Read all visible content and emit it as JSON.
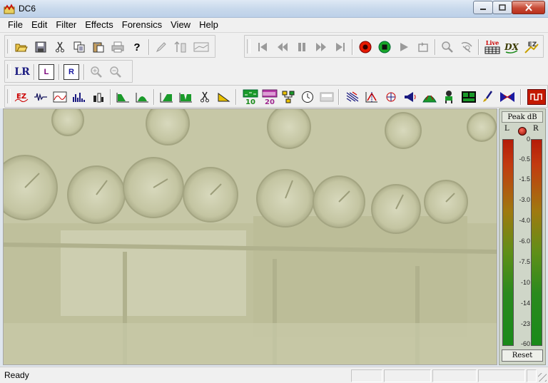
{
  "window": {
    "title": "DC6",
    "status": "Ready"
  },
  "menu": [
    "File",
    "Edit",
    "Filter",
    "Effects",
    "Forensics",
    "View",
    "Help"
  ],
  "icons": {
    "toolbar1_file": [
      "open-folder-icon",
      "save-icon",
      "cut-icon",
      "copy-icon",
      "paste-icon",
      "print-icon",
      "help-icon",
      "pencil-icon",
      "level-icon",
      "waveform-icon"
    ],
    "toolbar1_transport": [
      "skip-start-icon",
      "rewind-icon",
      "pause-icon",
      "fast-forward-icon",
      "skip-end-icon",
      "record-icon",
      "stop-icon",
      "play-icon",
      "loop-icon",
      "zoom-icon",
      "probe-icon",
      "live-icon",
      "dx-icon",
      "ez-icon"
    ],
    "toolbar2": [
      "lr-icon",
      "l-channel-icon",
      "r-channel-icon",
      "zoom-in-icon",
      "zoom-out-icon"
    ],
    "toolbar3": [
      "ez-filter-icon",
      "noise-icon",
      "spectrum-icon",
      "histogram-icon",
      "bars-icon",
      "lowpass-icon",
      "bandpass-icon",
      "highpass-icon",
      "notch-icon",
      "scissors-icon",
      "ramp-icon",
      "eq10-icon",
      "eq20-icon",
      "tree-icon",
      "clock-icon",
      "blank-icon",
      "wavelet-icon",
      "filter-icon",
      "decrackle-icon",
      "speaker-icon",
      "mountain-icon",
      "figure-icon",
      "graph-icon",
      "brush-icon",
      "bowtie-icon",
      "square-wave-icon"
    ]
  },
  "labels": {
    "lr": "LR",
    "l": "L",
    "r": "R",
    "eq10": "10",
    "eq20": "20",
    "live": "Live",
    "dx": "DX",
    "ez": "EZ"
  },
  "meter": {
    "header": "Peak dB",
    "left_label": "L",
    "right_label": "R",
    "scale": [
      "0",
      "-0.5",
      "-1.5",
      "-3.0",
      "-4.0",
      "-6.0",
      "-7.5",
      "-10",
      "-14",
      "-23",
      "-60"
    ],
    "reset": "Reset"
  },
  "colors": {
    "accent_red": "#cc1a00",
    "meter_green": "#1a8a1a",
    "workspace_bg": "#c7c8a8"
  }
}
